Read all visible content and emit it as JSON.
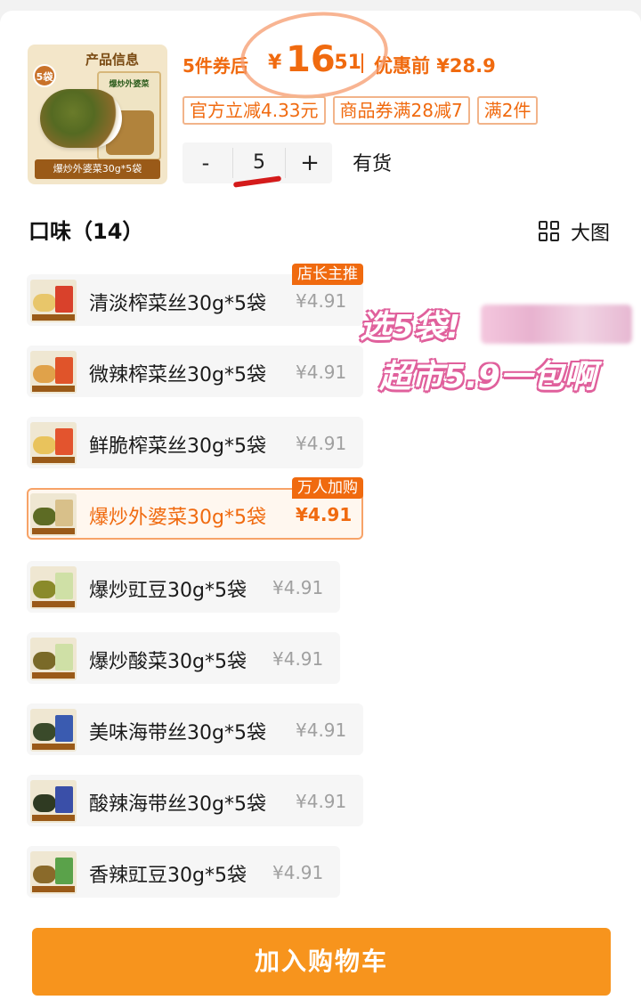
{
  "product": {
    "thumb_title": "产品信息",
    "thumb_badge": "5袋",
    "thumb_pack_text": "爆炒外婆菜",
    "thumb_caption": "爆炒外婆菜30g*5袋"
  },
  "price": {
    "lead": "5件券后",
    "yen": "¥",
    "integer": "16",
    "decimal": ".51",
    "original_label": "优惠前 ¥28.9"
  },
  "coupons": [
    "官方立减4.33元",
    "商品券满28减7",
    "满2件"
  ],
  "stepper": {
    "minus": "-",
    "quantity": "5",
    "plus": "+"
  },
  "stock_status": "有货",
  "section_title": "口味（14）",
  "big_view_label": "大图",
  "flavors": [
    {
      "name": "清淡榨菜丝30g*5袋",
      "price": "¥4.91",
      "tag": "店长主推",
      "selected": false,
      "pack_color": "#d9412b",
      "food_color": "#e8c66a"
    },
    {
      "name": "微辣榨菜丝30g*5袋",
      "price": "¥4.91",
      "tag": "",
      "selected": false,
      "pack_color": "#e0542a",
      "food_color": "#e0a24a"
    },
    {
      "name": "鲜脆榨菜丝30g*5袋",
      "price": "¥4.91",
      "tag": "",
      "selected": false,
      "pack_color": "#e3542e",
      "food_color": "#e9c35c"
    },
    {
      "name": "爆炒外婆菜30g*5袋",
      "price": "¥4.91",
      "tag": "万人加购",
      "selected": true,
      "pack_color": "#d8c08a",
      "food_color": "#5d6b24"
    },
    {
      "name": "爆炒豇豆30g*5袋",
      "price": "¥4.91",
      "tag": "",
      "selected": false,
      "pack_color": "#cfe0a6",
      "food_color": "#8a8a2a"
    },
    {
      "name": "爆炒酸菜30g*5袋",
      "price": "¥4.91",
      "tag": "",
      "selected": false,
      "pack_color": "#cfe0a6",
      "food_color": "#7a6a28"
    },
    {
      "name": "美味海带丝30g*5袋",
      "price": "¥4.91",
      "tag": "",
      "selected": false,
      "pack_color": "#3a5bb0",
      "food_color": "#3a4a2a"
    },
    {
      "name": "酸辣海带丝30g*5袋",
      "price": "¥4.91",
      "tag": "",
      "selected": false,
      "pack_color": "#3a4fa8",
      "food_color": "#2f3a22"
    },
    {
      "name": "香辣豇豆30g*5袋",
      "price": "¥4.91",
      "tag": "",
      "selected": false,
      "pack_color": "#5aa24a",
      "food_color": "#8a6a2a"
    }
  ],
  "promo_overlay": {
    "line1": "选5袋!",
    "line2": "超市5.9一包啊"
  },
  "cart_button": "加入购物车",
  "colors": {
    "accent": "#f06a0f",
    "button": "#f7941d",
    "overlay_pink": "#e0609c"
  }
}
